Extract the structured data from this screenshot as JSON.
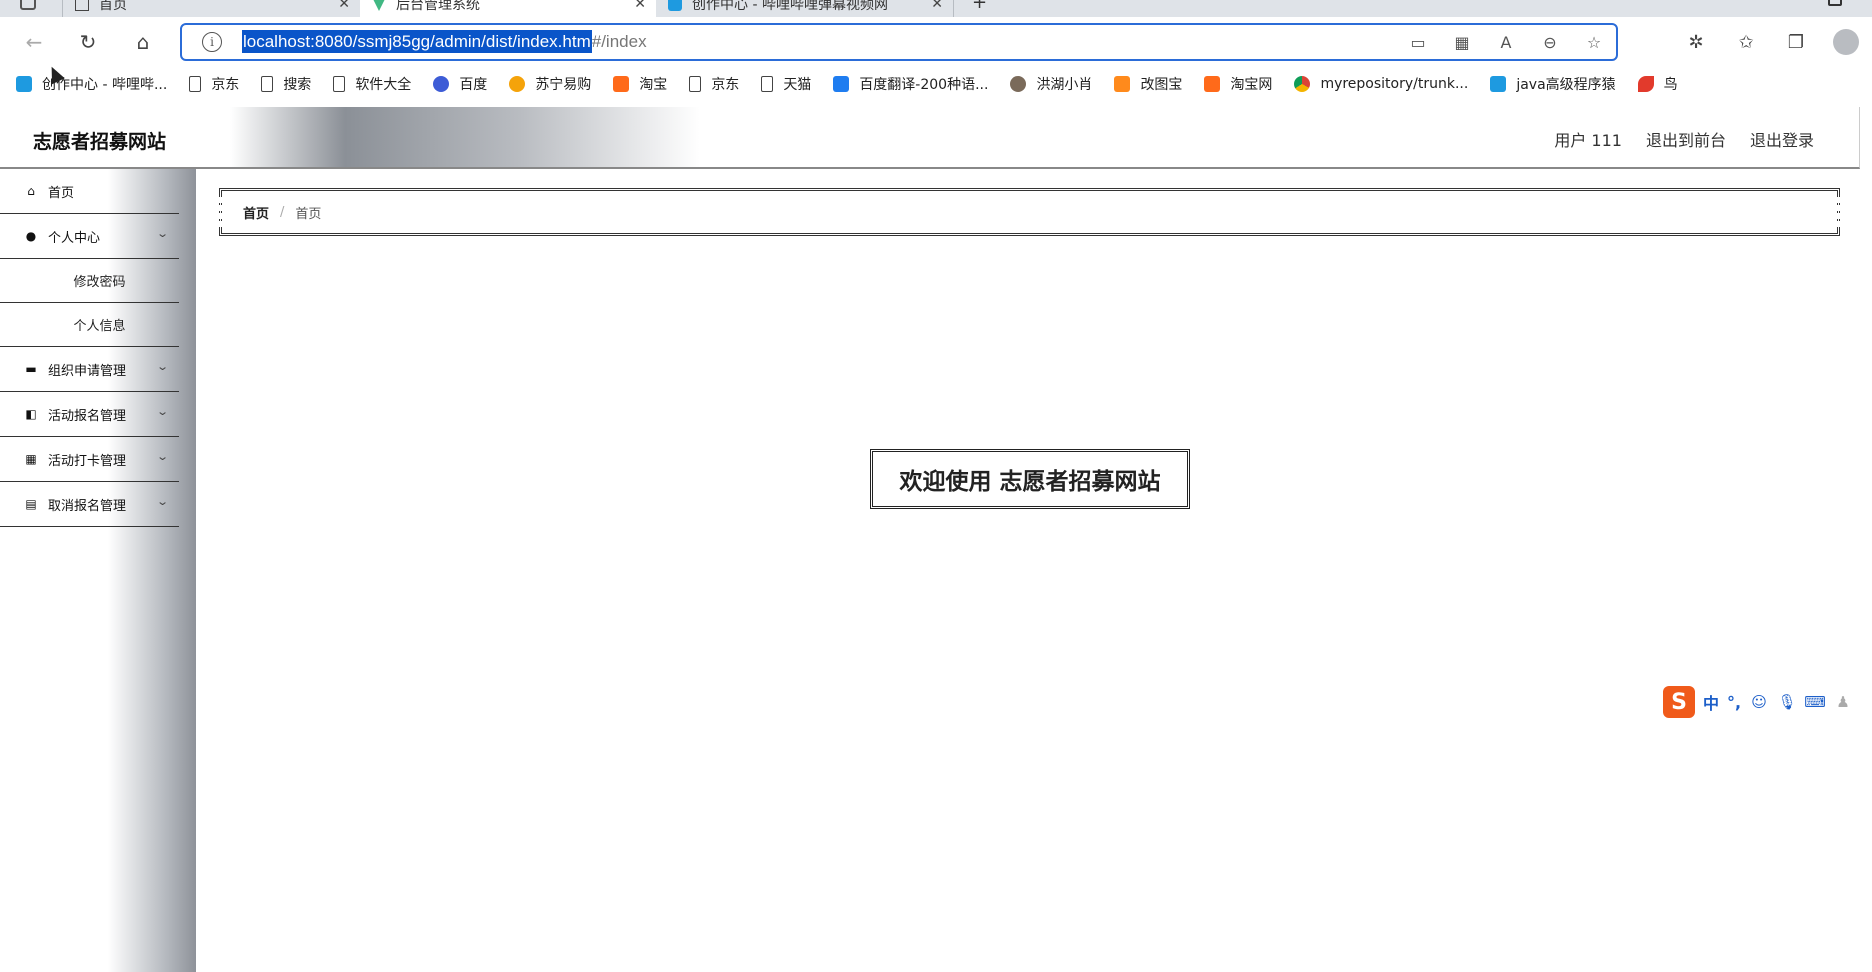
{
  "browser": {
    "tabs": [
      {
        "title": "首页",
        "active": false
      },
      {
        "title": "后台管理系统",
        "active": true
      },
      {
        "title": "创作中心 - 哔哩哔哩弹幕视频网",
        "active": false
      }
    ],
    "address": {
      "url_selected": "localhost:8080/ssmj85gg/admin/dist/index.htm",
      "url_rest": "#/index"
    },
    "bookmarks": [
      {
        "label": "创作中心 - 哔哩哔...",
        "icon": "bilibili-icon"
      },
      {
        "label": "京东",
        "icon": "page-icon"
      },
      {
        "label": "搜索",
        "icon": "page-icon"
      },
      {
        "label": "软件大全",
        "icon": "page-icon"
      },
      {
        "label": "百度",
        "icon": "baidu-icon"
      },
      {
        "label": "苏宁易购",
        "icon": "suning-icon"
      },
      {
        "label": "淘宝",
        "icon": "taobao-icon"
      },
      {
        "label": "京东",
        "icon": "page-icon"
      },
      {
        "label": "天猫",
        "icon": "page-icon"
      },
      {
        "label": "百度翻译-200种语...",
        "icon": "translate-icon"
      },
      {
        "label": "洪湖小肖",
        "icon": "avatar-icon"
      },
      {
        "label": "改图宝",
        "icon": "gaitubao-icon"
      },
      {
        "label": "淘宝网",
        "icon": "taobao-icon"
      },
      {
        "label": "myrepository/trunk...",
        "icon": "chrome-icon"
      },
      {
        "label": "java高级程序猿",
        "icon": "bilibili-icon"
      },
      {
        "label": "鸟",
        "icon": "bird-icon"
      }
    ]
  },
  "app": {
    "site_title": "志愿者招募网站",
    "header": {
      "user": "用户 111",
      "to_front": "退出到前台",
      "logout": "退出登录"
    },
    "sidebar": {
      "home": "首页",
      "personal_center": "个人中心",
      "change_password": "修改密码",
      "personal_info": "个人信息",
      "org_apply": "组织申请管理",
      "activity_signup": "活动报名管理",
      "activity_checkin": "活动打卡管理",
      "cancel_signup": "取消报名管理"
    },
    "breadcrumb": {
      "home": "首页",
      "separator": "/",
      "current": "首页"
    },
    "welcome": "欢迎使用 志愿者招募网站"
  },
  "ime": {
    "logo": "S",
    "mode": "中",
    "punct": "°,"
  }
}
